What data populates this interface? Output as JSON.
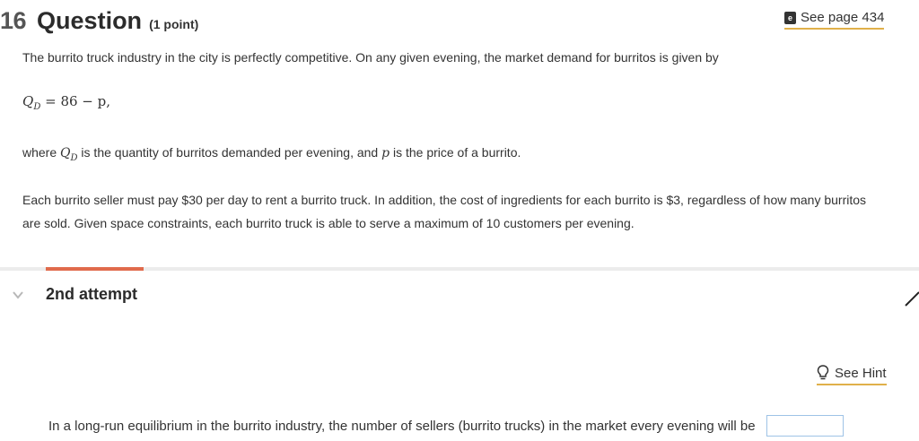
{
  "question": {
    "number": "16",
    "word": "Question",
    "points": "(1 point)"
  },
  "see_page": {
    "label": "See page 434",
    "icon": "ebook-icon",
    "icon_glyph": "e"
  },
  "body": {
    "p1": "The burrito truck industry in the city is perfectly competitive. On any given evening, the market demand for burritos is given by",
    "equation": {
      "lhs": "Q",
      "lhs_sub": "D",
      "rhs": " = 86 − p,"
    },
    "p2_pre": "where ",
    "p2_var": "Q",
    "p2_var_sub": "D",
    "p2_mid": " is the quantity of burritos demanded per evening, and ",
    "p2_p": "p",
    "p2_post": " is the price of a burrito.",
    "p3": "Each burrito seller must pay $30 per day to rent a burrito truck. In addition, the cost of ingredients for each burrito is $3, regardless of how many burritos are sold. Given space constraints, each burrito truck is able to serve a maximum of 10 customers per evening."
  },
  "attempt": {
    "title": "2nd attempt"
  },
  "hint": {
    "label": "See Hint",
    "icon": "lightbulb-icon"
  },
  "answer": {
    "prompt": "In a long-run equilibrium in the burrito industry, the number of sellers (burrito trucks) in the market every evening will be",
    "value": ""
  },
  "colors": {
    "accent_underline": "#e0b04a",
    "progress_accent": "#e06a4c",
    "input_border": "#9ec3e6"
  }
}
